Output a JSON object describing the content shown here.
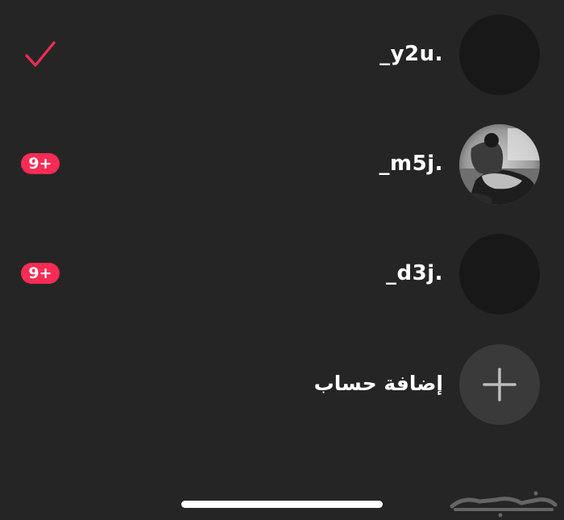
{
  "accounts": [
    {
      "username": "_y2u.",
      "selected": true,
      "badge": ""
    },
    {
      "username": "_m5j.",
      "selected": false,
      "badge": "9+"
    },
    {
      "username": "_d3j.",
      "selected": false,
      "badge": "9+"
    }
  ],
  "add_account": {
    "label": "إضافة حساب",
    "icon": "plus-icon"
  },
  "icons": {
    "selected": "check-icon",
    "watermark": "haraj-logo"
  },
  "colors": {
    "background": "#252525",
    "accent": "#fe2c55",
    "avatar_placeholder": "#181818",
    "add_button": "#3a3a3a"
  },
  "watermark_text": "حراج"
}
